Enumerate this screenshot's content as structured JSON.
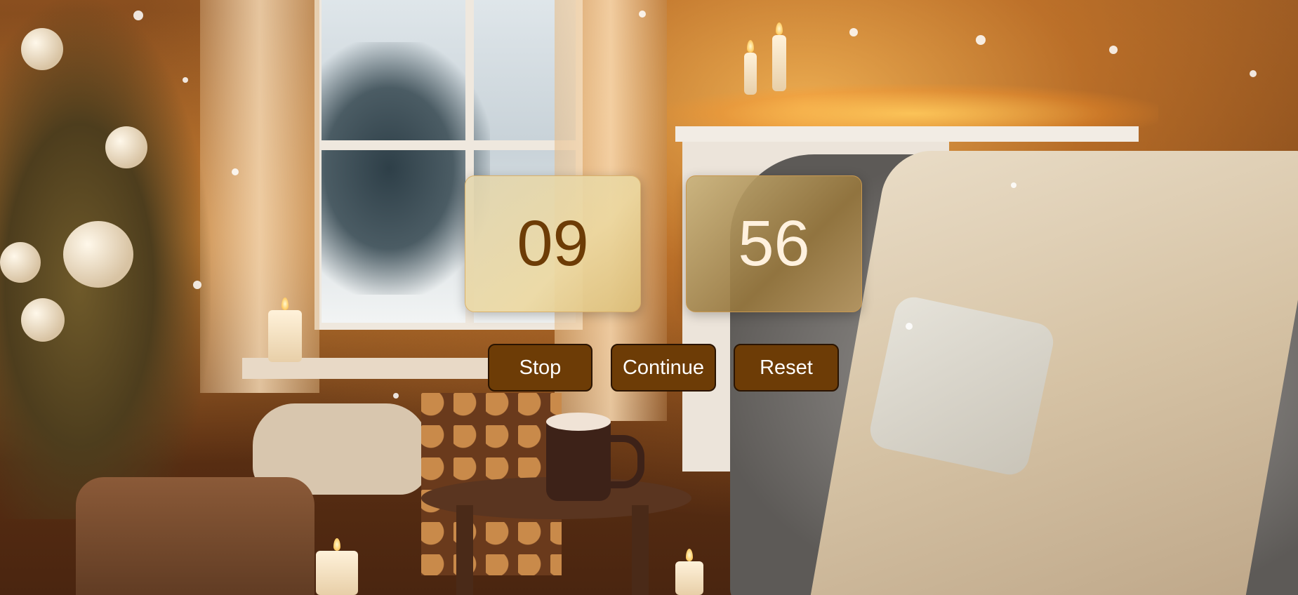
{
  "timer": {
    "minutes": "09",
    "seconds": "56"
  },
  "controls": {
    "stop_label": "Stop",
    "continue_label": "Continue",
    "reset_label": "Reset"
  },
  "colors": {
    "button_bg": "#6d3c06",
    "minutes_text": "#6d3c06",
    "seconds_text": "#fff1de"
  },
  "background": {
    "description_icon": "cozy-christmas-room-background"
  }
}
